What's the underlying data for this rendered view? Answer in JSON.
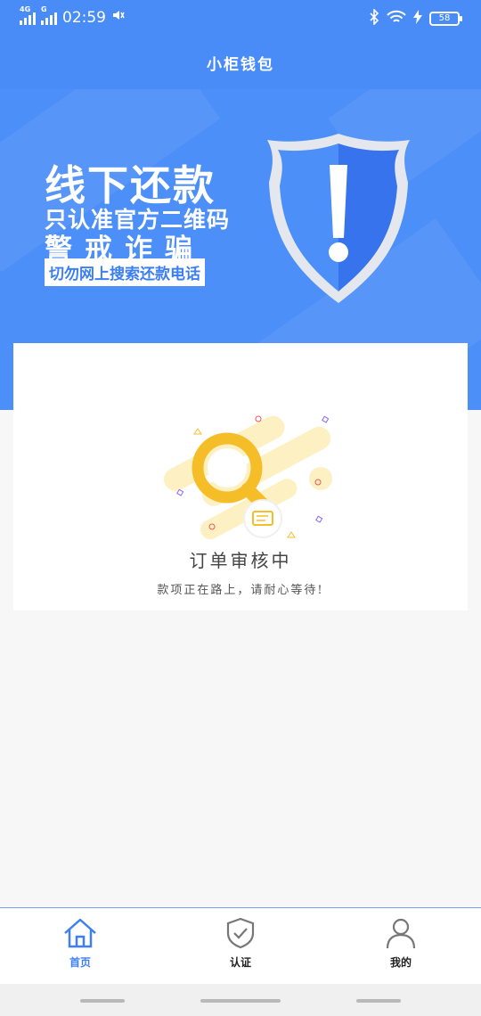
{
  "status_bar": {
    "network1": "4G",
    "network2": "G",
    "time": "02:59",
    "battery": "58"
  },
  "header": {
    "title": "小柜钱包"
  },
  "banner": {
    "line1": "线下还款",
    "line2": "只认准官方二维码",
    "line3": "警戒诈骗",
    "tag": "切勿网上搜索还款电话",
    "colors": {
      "background": "#4d8ff8",
      "shield": "#3d7ef2"
    }
  },
  "status_card": {
    "title": "订单审核中",
    "subtitle": "款项正在路上，请耐心等待!"
  },
  "bottom_nav": {
    "items": [
      {
        "label": "首页",
        "icon": "home-icon",
        "active": true
      },
      {
        "label": "认证",
        "icon": "shield-check-icon",
        "active": false
      },
      {
        "label": "我的",
        "icon": "person-icon",
        "active": false
      }
    ],
    "active_color": "#3e7ff2"
  }
}
